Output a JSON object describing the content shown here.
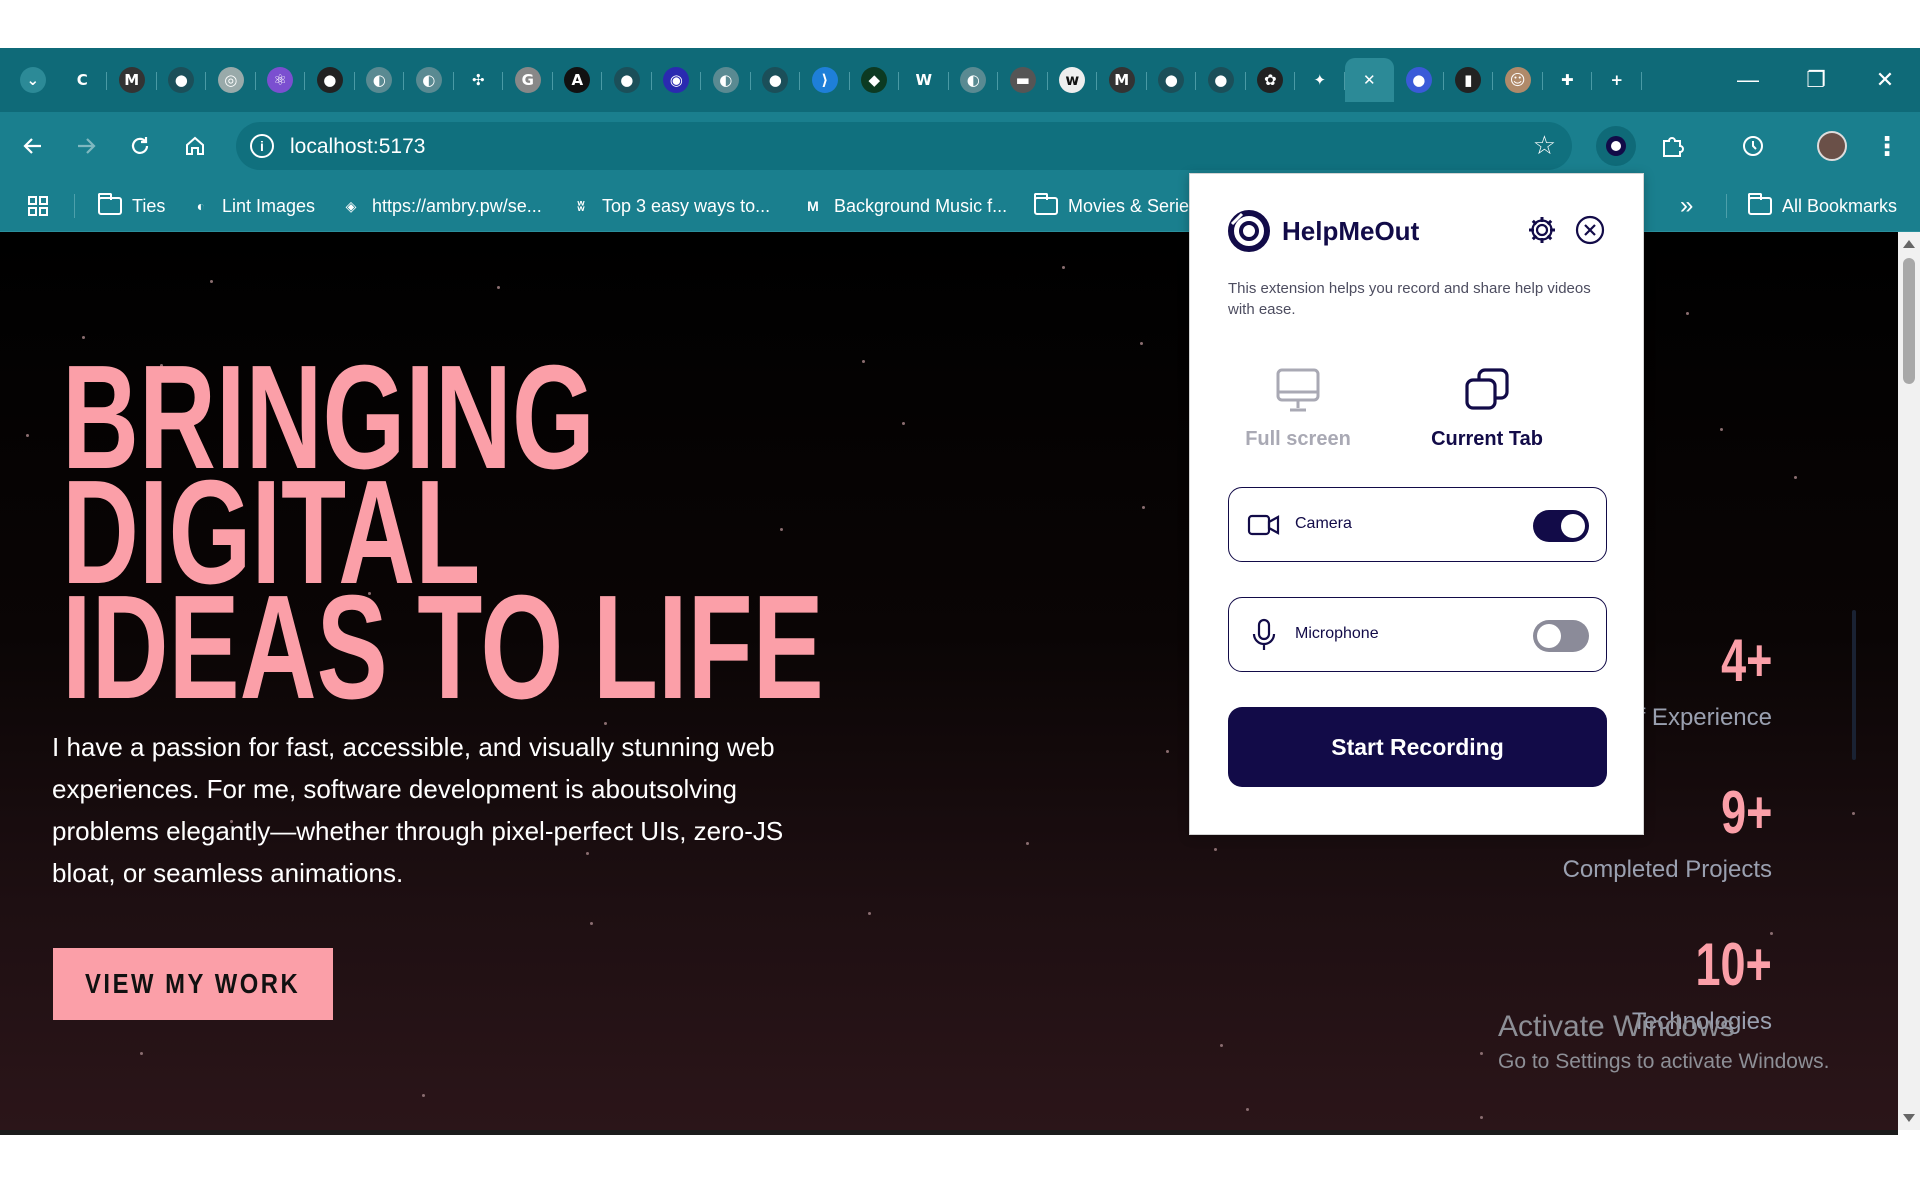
{
  "browser": {
    "tabs": [
      {
        "icon": "tab-search-icon",
        "glyph": "⌄",
        "bg": "#2c8a97"
      },
      {
        "icon": "c-logo-icon",
        "glyph": "C",
        "bg": ""
      },
      {
        "icon": "medium-icon",
        "glyph": "M",
        "bg": "#333"
      },
      {
        "icon": "github-icon",
        "glyph": "●",
        "bg": "#1b4f59"
      },
      {
        "icon": "dribbble-icon",
        "glyph": "◎",
        "bg": "#9aa"
      },
      {
        "icon": "react-icon",
        "glyph": "⚛",
        "bg": "#7b4fd0"
      },
      {
        "icon": "github-icon",
        "glyph": "●",
        "bg": "#222"
      },
      {
        "icon": "globe-icon",
        "glyph": "◐",
        "bg": "#5a8a92"
      },
      {
        "icon": "globe-icon",
        "glyph": "◐",
        "bg": "#5a8a92"
      },
      {
        "icon": "link-icon",
        "glyph": "✣",
        "bg": ""
      },
      {
        "icon": "gt-icon",
        "glyph": "G",
        "bg": "#888"
      },
      {
        "icon": "a-logo-icon",
        "glyph": "A",
        "bg": "#111"
      },
      {
        "icon": "github-icon",
        "glyph": "●",
        "bg": "#1b4f59"
      },
      {
        "icon": "spiral-icon",
        "glyph": "◉",
        "bg": "#2a2ab0"
      },
      {
        "icon": "globe-icon",
        "glyph": "◐",
        "bg": "#5a8a92"
      },
      {
        "icon": "github-icon",
        "glyph": "●",
        "bg": "#1b4f59"
      },
      {
        "icon": "vscode-icon",
        "glyph": "⟩",
        "bg": "#1e7fd8"
      },
      {
        "icon": "diamond-icon",
        "glyph": "◆",
        "bg": "#0c3a22"
      },
      {
        "icon": "w-logo-icon",
        "glyph": "W",
        "bg": ""
      },
      {
        "icon": "globe-icon",
        "glyph": "◐",
        "bg": "#5a8a92"
      },
      {
        "icon": "dark-app-icon",
        "glyph": "▬",
        "bg": "#555"
      },
      {
        "icon": "w-circle-icon",
        "glyph": "w",
        "bg": "#eee"
      },
      {
        "icon": "medium-icon",
        "glyph": "M",
        "bg": "#333"
      },
      {
        "icon": "github-icon",
        "glyph": "●",
        "bg": "#1b4f59"
      },
      {
        "icon": "github-icon",
        "glyph": "●",
        "bg": "#1b4f59"
      },
      {
        "icon": "chatgpt-icon",
        "glyph": "✿",
        "bg": "#222"
      },
      {
        "icon": "gemini-icon",
        "glyph": "✦",
        "bg": ""
      },
      {
        "icon": "close-tab-icon",
        "glyph": "✕",
        "bg": "",
        "active": true
      },
      {
        "icon": "drop-icon",
        "glyph": "●",
        "bg": "#3a5ad8"
      },
      {
        "icon": "bars-icon",
        "glyph": "▮",
        "bg": "#222"
      },
      {
        "icon": "avatar-icon",
        "glyph": "☺",
        "bg": "#b08a6a"
      },
      {
        "icon": "puzzle-icon",
        "glyph": "✚",
        "bg": ""
      },
      {
        "icon": "new-tab-icon",
        "glyph": "+",
        "bg": ""
      }
    ],
    "url": "localhost:5173",
    "bookmarks": [
      {
        "label": "Ties",
        "type": "folder"
      },
      {
        "label": "Lint Images",
        "type": "site",
        "glyph": "◐"
      },
      {
        "label": "https://ambry.pw/se...",
        "type": "site",
        "glyph": "◈"
      },
      {
        "label": "Top 3 easy ways to...",
        "type": "site",
        "glyph": "ʬ"
      },
      {
        "label": "Background Music f...",
        "type": "site",
        "glyph": "M"
      },
      {
        "label": "Movies & Serie",
        "type": "folder"
      }
    ],
    "more_bookmarks": "»",
    "all_bookmarks": "All Bookmarks"
  },
  "hero": {
    "title_lines": [
      "BRINGING",
      "DIGITAL",
      "IDEAS TO LIFE"
    ],
    "text": "I have a passion for fast, accessible, and visually stunning web experiences. For me, software development is aboutsolving problems elegantly—whether through pixel-perfect UIs, zero-JS bloat, or seamless animations.",
    "cta": "VIEW MY WORK"
  },
  "stats": [
    {
      "number": "4+",
      "label": "f Experience"
    },
    {
      "number": "9+",
      "label": "Completed Projects"
    },
    {
      "number": "10+",
      "label": "Technologies"
    }
  ],
  "windows_watermark": {
    "line1": "Activate Windows",
    "line2": "Go to Settings to activate Windows."
  },
  "popup": {
    "brand": "HelpMeOut",
    "description": "This extension helps you record and share help videos with ease.",
    "modes": [
      {
        "label": "Full screen",
        "selected": false
      },
      {
        "label": "Current Tab",
        "selected": true
      }
    ],
    "camera": {
      "label": "Camera",
      "on": true
    },
    "microphone": {
      "label": "Microphone",
      "on": false
    },
    "record_button": "Start Recording"
  },
  "colors": {
    "browser_tab_bar": "#0f6a78",
    "browser_toolbar": "#1a7f8e",
    "accent_pink": "#fb9fa8",
    "brand_navy": "#120b48"
  }
}
